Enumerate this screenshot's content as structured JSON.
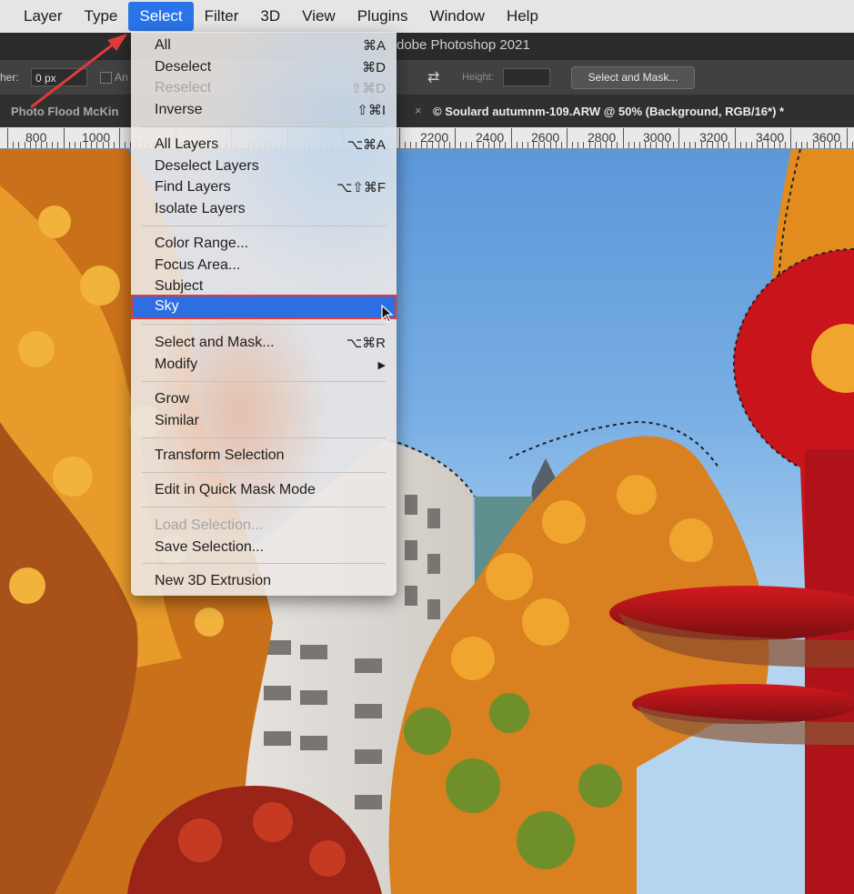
{
  "menubar": {
    "items": [
      {
        "label": "Layer"
      },
      {
        "label": "Type"
      },
      {
        "label": "Select"
      },
      {
        "label": "Filter"
      },
      {
        "label": "3D"
      },
      {
        "label": "View"
      },
      {
        "label": "Plugins"
      },
      {
        "label": "Window"
      },
      {
        "label": "Help"
      }
    ],
    "active": "Select"
  },
  "titlebar": {
    "title": "dobe Photoshop 2021"
  },
  "options": {
    "feather_label": "her:",
    "feather_value": "0 px",
    "anti_alias_label": "An",
    "height_label": "Height:",
    "select_and_mask": "Select and Mask..."
  },
  "tabs": {
    "tab1": "Photo Flood McKin",
    "tab2_close": "×",
    "tab2": "© Soulard autumnm-109.ARW @ 50% (Background, RGB/16*) *"
  },
  "ruler": {
    "labels": [
      "800",
      "1000",
      "2200",
      "2400",
      "2600",
      "2800",
      "3000",
      "3200",
      "3400",
      "3600"
    ]
  },
  "select_menu": {
    "items": [
      {
        "label": "All",
        "shortcut": "⌘A",
        "disabled": false
      },
      {
        "label": "Deselect",
        "shortcut": "⌘D",
        "disabled": false
      },
      {
        "label": "Reselect",
        "shortcut": "⇧⌘D",
        "disabled": true
      },
      {
        "label": "Inverse",
        "shortcut": "⇧⌘I",
        "disabled": false
      },
      {
        "label": "All Layers",
        "shortcut": "⌥⌘A",
        "disabled": false
      },
      {
        "label": "Deselect Layers",
        "shortcut": "",
        "disabled": false
      },
      {
        "label": "Find Layers",
        "shortcut": "⌥⇧⌘F",
        "disabled": false
      },
      {
        "label": "Isolate Layers",
        "shortcut": "",
        "disabled": false
      },
      {
        "label": "Color Range...",
        "shortcut": "",
        "disabled": false
      },
      {
        "label": "Focus Area...",
        "shortcut": "",
        "disabled": false
      },
      {
        "label": "Subject",
        "shortcut": "",
        "disabled": false
      },
      {
        "label": "Sky",
        "shortcut": "",
        "disabled": false,
        "highlighted": true
      },
      {
        "label": "Select and Mask...",
        "shortcut": "⌥⌘R",
        "disabled": false
      },
      {
        "label": "Modify",
        "shortcut": "▶",
        "disabled": false
      },
      {
        "label": "Grow",
        "shortcut": "",
        "disabled": false
      },
      {
        "label": "Similar",
        "shortcut": "",
        "disabled": false
      },
      {
        "label": "Transform Selection",
        "shortcut": "",
        "disabled": false
      },
      {
        "label": "Edit in Quick Mask Mode",
        "shortcut": "",
        "disabled": false
      },
      {
        "label": "Load Selection...",
        "shortcut": "",
        "disabled": true
      },
      {
        "label": "Save Selection...",
        "shortcut": "",
        "disabled": false
      },
      {
        "label": "New 3D Extrusion",
        "shortcut": "",
        "disabled": false
      }
    ],
    "submenu_arrow": "▶"
  },
  "colors": {
    "menu_highlight": "#2d6fe3",
    "annotation_red": "#e03a3a",
    "sculpture_red": "#c8141b",
    "sky_blue": "#78aee4",
    "foliage_orange": "#e08a1e"
  }
}
